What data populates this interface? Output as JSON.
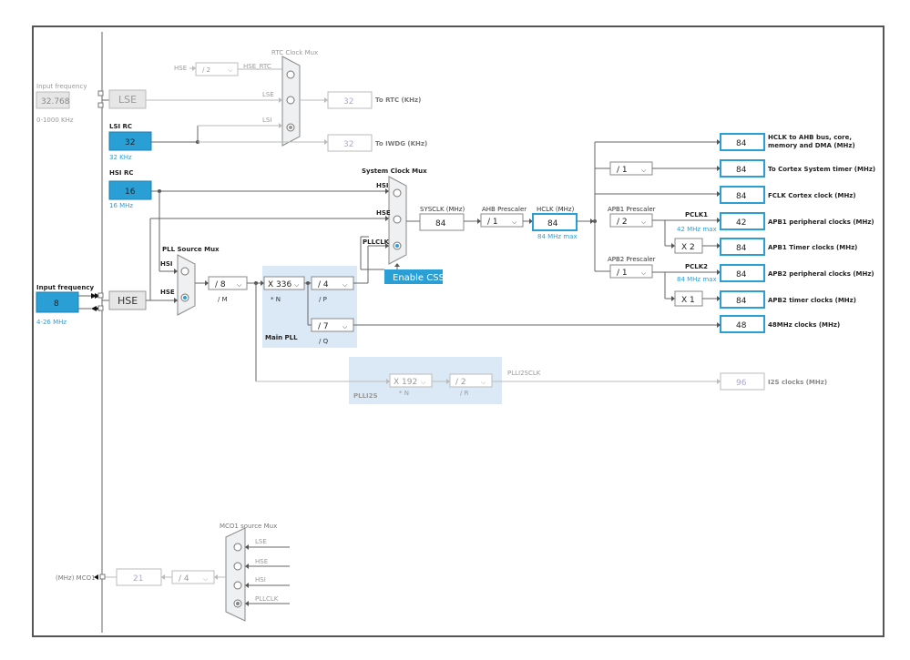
{
  "rtc_mux": {
    "title": "RTC Clock Mux",
    "hse_div": "/ 2",
    "hse_label": "HSE",
    "hse_rtc_label": "HSE_RTC",
    "lse_label": "LSE",
    "lsi_label": "LSI"
  },
  "lse": {
    "input_label": "Input frequency",
    "input_value": "32.768",
    "range": "0-1000 KHz",
    "name": "LSE"
  },
  "rtc_out": {
    "value": "32",
    "label": "To RTC (KHz)"
  },
  "lsi": {
    "title": "LSI RC",
    "value": "32",
    "unit": "32 KHz"
  },
  "iwdg_out": {
    "value": "32",
    "label": "To IWDG (KHz)"
  },
  "hsi": {
    "title": "HSI RC",
    "value": "16",
    "unit": "16 MHz"
  },
  "sys_mux": {
    "title": "System Clock Mux",
    "hsi": "HSI",
    "hse": "HSE",
    "pllclk": "PLLCLK"
  },
  "pll_mux": {
    "title": "PLL Source Mux",
    "hsi": "HSI",
    "hse": "HSE"
  },
  "hse": {
    "input_label": "Input frequency",
    "input_value": "8",
    "range": "4-26 MHz",
    "name": "HSE"
  },
  "pll": {
    "m_value": "/ 8",
    "m_label": "/ M",
    "n_value": "X 336",
    "n_label": "* N",
    "p_value": "/ 4",
    "p_label": "/ P",
    "q_value": "/ 7",
    "q_label": "/ Q",
    "title": "Main PLL"
  },
  "enable_css": "Enable CSS",
  "sysclk": {
    "label": "SYSCLK (MHz)",
    "value": "84"
  },
  "ahb": {
    "label": "AHB Prescaler",
    "value": "/ 1"
  },
  "hclk": {
    "label": "HCLK (MHz)",
    "value": "84",
    "max": "84 MHz max"
  },
  "apb1": {
    "label": "APB1 Prescaler",
    "value": "/ 2",
    "pclk": "PCLK1",
    "max": "42 MHz max",
    "timer_mult": "X 2"
  },
  "apb2": {
    "label": "APB2 Prescaler",
    "value": "/ 1",
    "pclk": "PCLK2",
    "max": "84 MHz max",
    "timer_mult": "X 1"
  },
  "cortex_div": "/ 1",
  "outputs": [
    {
      "value": "84",
      "label1": "HCLK to AHB bus, core,",
      "label2": "memory and DMA (MHz)"
    },
    {
      "value": "84",
      "label1": "To Cortex System timer (MHz)",
      "label2": ""
    },
    {
      "value": "84",
      "label1": "FCLK Cortex clock (MHz)",
      "label2": ""
    },
    {
      "value": "42",
      "label1": "APB1 peripheral clocks (MHz)",
      "label2": ""
    },
    {
      "value": "84",
      "label1": "APB1 Timer clocks (MHz)",
      "label2": ""
    },
    {
      "value": "84",
      "label1": "APB2 peripheral clocks (MHz)",
      "label2": ""
    },
    {
      "value": "84",
      "label1": "APB2 timer clocks (MHz)",
      "label2": ""
    },
    {
      "value": "48",
      "label1": "48MHz clocks (MHz)",
      "label2": ""
    }
  ],
  "plli2s": {
    "n_value": "X 192",
    "n_label": "* N",
    "r_value": "/ 2",
    "r_label": "/ R",
    "title": "PLLI2S",
    "clk_label": "PLLI2SCLK",
    "out_value": "96",
    "out_label": "I2S clocks (MHz)"
  },
  "mco1": {
    "title": "MCO1 source Mux",
    "lse": "LSE",
    "hse": "HSE",
    "hsi": "HSI",
    "pllclk": "PLLCLK",
    "div": "/ 4",
    "value": "21",
    "label": "(MHz) MCO1"
  }
}
